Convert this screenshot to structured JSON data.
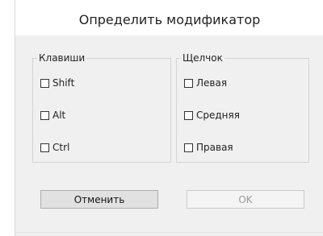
{
  "dialog": {
    "title": "Определить модификатор",
    "keys_group": {
      "label": "Клавиши",
      "options": [
        {
          "label": "Shift",
          "checked": false
        },
        {
          "label": "Alt",
          "checked": false
        },
        {
          "label": "Ctrl",
          "checked": false
        }
      ]
    },
    "click_group": {
      "label": "Щелчок",
      "options": [
        {
          "label": "Левая",
          "checked": false
        },
        {
          "label": "Средняя",
          "checked": false
        },
        {
          "label": "Правая",
          "checked": false
        }
      ]
    },
    "buttons": {
      "cancel_label": "Отменить",
      "ok_label": "OK",
      "ok_enabled": false
    }
  }
}
